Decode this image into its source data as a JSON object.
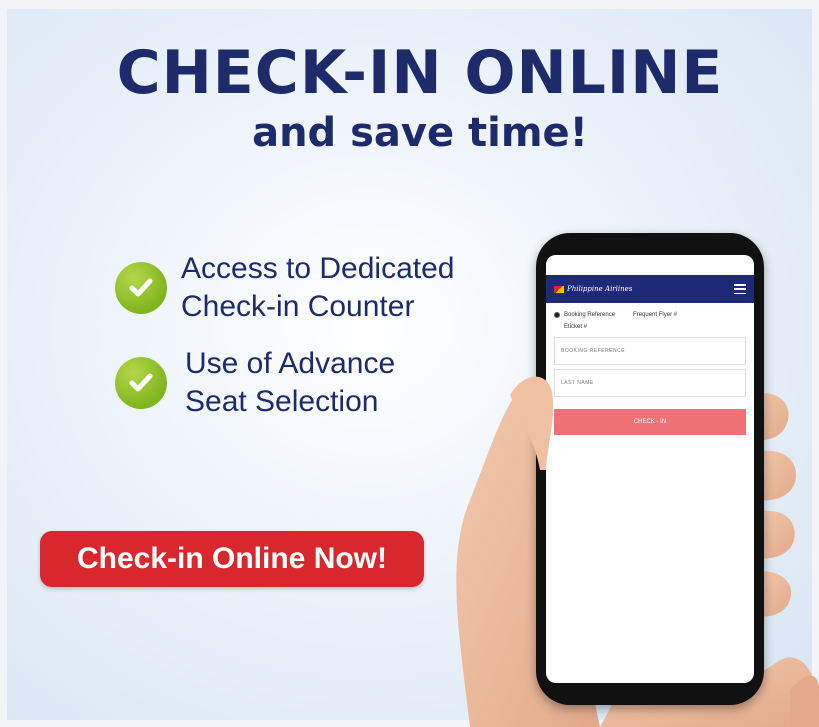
{
  "header": {
    "title": "CHECK-IN ONLINE",
    "subtitle": "and save time!"
  },
  "features": [
    {
      "line1": "Access to Dedicated",
      "line2": "Check-in Counter",
      "icon": "check-icon"
    },
    {
      "line1": "Use of Advance",
      "line2": "Seat Selection",
      "icon": "check-icon"
    }
  ],
  "cta": {
    "label": "Check-in Online Now!"
  },
  "phone_app": {
    "logo": "Philippine Airlines",
    "radio_booking": "Booking Reference",
    "radio_frequent": "Frequent Flyer #",
    "radio_eticket": "Eticket #",
    "field_booking_placeholder": "BOOKING REFERENCE",
    "field_lastname_placeholder": "LAST NAME",
    "button_label": "CHECK - IN"
  },
  "colors": {
    "navy": "#1d2b6b",
    "check_green": "#7fb51d",
    "cta_red": "#d9272e",
    "app_bar": "#1e2a78",
    "app_button": "#ee7276"
  }
}
